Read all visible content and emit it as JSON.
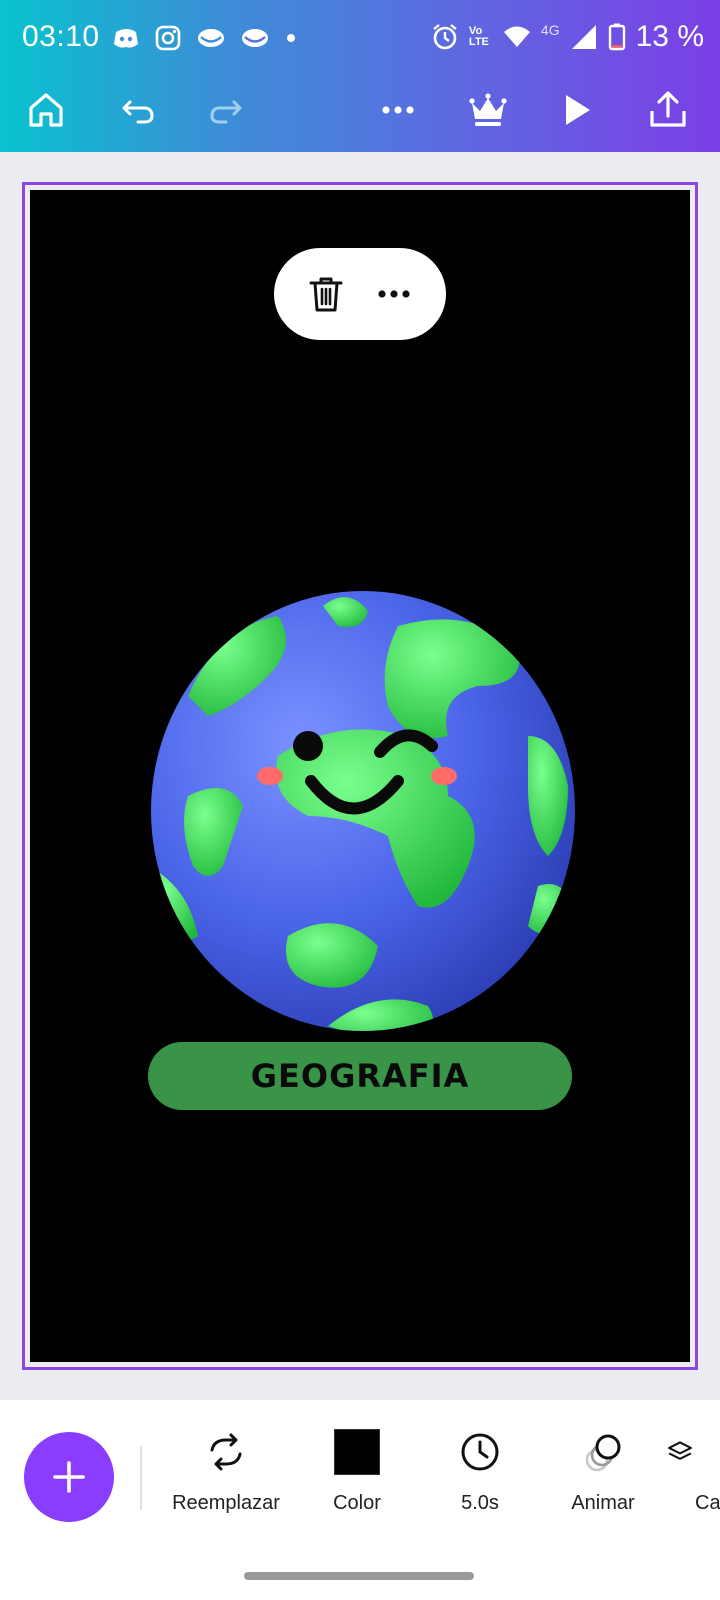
{
  "status_bar": {
    "time": "03:10",
    "battery": "13 %",
    "network": "4G",
    "volte": "Vo LTE"
  },
  "toolbar": {
    "icons": [
      "home-icon",
      "undo-icon",
      "redo-icon",
      "more-icon",
      "crown-icon",
      "play-icon",
      "share-icon"
    ]
  },
  "canvas": {
    "background": "#000000",
    "label": "GEOGRAFIA",
    "label_color": "#3a9447"
  },
  "bottom_toolbar": {
    "tools": [
      {
        "label": "Reemplazar",
        "icon": "replace-icon"
      },
      {
        "label": "Color",
        "icon": "color-swatch"
      },
      {
        "label": "5.0s",
        "icon": "clock-icon"
      },
      {
        "label": "Animar",
        "icon": "animate-icon"
      },
      {
        "label": "Ca",
        "icon": "layers-icon"
      }
    ]
  },
  "colors": {
    "accent": "#8b3dff",
    "gradient_start": "#07c3ce",
    "gradient_end": "#7c3fe6"
  }
}
